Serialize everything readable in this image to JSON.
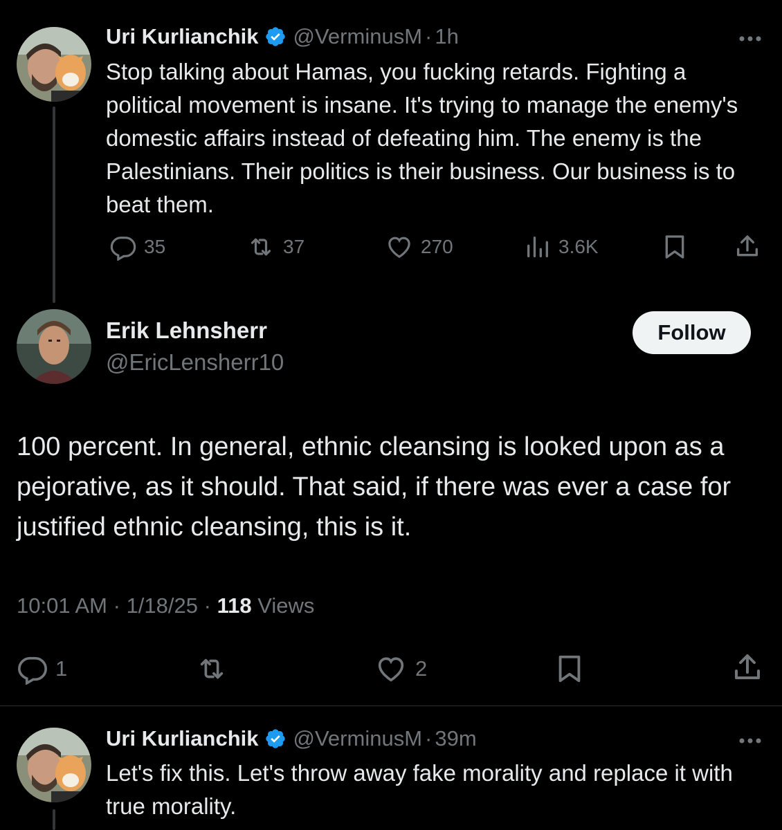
{
  "parent_tweet": {
    "display_name": "Uri Kurlianchik",
    "handle": "@VerminusM",
    "separator": "·",
    "age": "1h",
    "text": "Stop talking about Hamas, you fucking retards. Fighting a political movement is insane. It's trying to manage the enemy's domestic affairs instead of defeating him. The enemy is the Palestinians. Their politics is their business. Our business is to beat them.",
    "replies": "35",
    "reposts": "37",
    "likes": "270",
    "views": "3.6K"
  },
  "focused_tweet": {
    "display_name": "Erik Lehnsherr",
    "handle": "@EricLensherr10",
    "follow_label": "Follow",
    "text": "100 percent. In general, ethnic cleansing is looked upon as a pejorative, as it should. That said, if there was ever a case for justified ethnic cleansing, this is it.",
    "time": "10:01 AM",
    "date": "1/18/25",
    "separator": "·",
    "views_count": "118",
    "views_label": "Views",
    "replies": "1",
    "likes": "2"
  },
  "next_tweet": {
    "display_name": "Uri Kurlianchik",
    "handle": "@VerminusM",
    "separator": "·",
    "age": "39m",
    "text": "Let's fix this. Let's throw away fake morality and replace it with true morality."
  },
  "colors": {
    "background": "#000000",
    "text_primary": "#e7e9ea",
    "text_secondary": "#71767b",
    "verified": "#1d9bf0",
    "follow_button_bg": "#eff3f4"
  },
  "icons": [
    "reply-icon",
    "repost-icon",
    "like-icon",
    "views-icon",
    "bookmark-icon",
    "share-icon",
    "verified-badge-icon",
    "more-icon"
  ]
}
